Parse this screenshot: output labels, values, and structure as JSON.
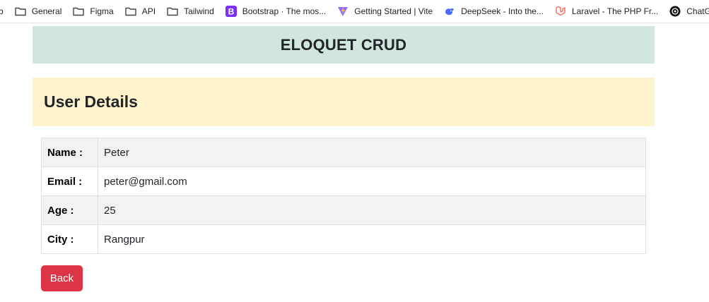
{
  "bookmarks": [
    {
      "label": "b",
      "icon": "none"
    },
    {
      "label": "General",
      "icon": "folder-icon"
    },
    {
      "label": "Figma",
      "icon": "folder-icon"
    },
    {
      "label": "API",
      "icon": "folder-icon"
    },
    {
      "label": "Tailwind",
      "icon": "folder-icon"
    },
    {
      "label": "Bootstrap · The mos...",
      "icon": "bootstrap-icon"
    },
    {
      "label": "Getting Started | Vite",
      "icon": "vite-icon"
    },
    {
      "label": "DeepSeek - Into the...",
      "icon": "deepseek-icon"
    },
    {
      "label": "Laravel - The PHP Fr...",
      "icon": "laravel-icon"
    },
    {
      "label": "ChatGPT",
      "icon": "chatgpt-icon"
    }
  ],
  "header": {
    "title": "ELOQUET CRUD"
  },
  "card": {
    "title": "User Details"
  },
  "details": [
    {
      "label": "Name :",
      "value": "Peter"
    },
    {
      "label": "Email :",
      "value": "peter@gmail.com"
    },
    {
      "label": "Age :",
      "value": "25"
    },
    {
      "label": "City :",
      "value": "Rangpur"
    }
  ],
  "actions": {
    "back_label": "Back"
  },
  "colors": {
    "header_bg": "#d1e7dd",
    "card_title_bg": "#fff3cd",
    "back_button_bg": "#dc3545",
    "striped_row_bg": "#f2f2f2"
  }
}
